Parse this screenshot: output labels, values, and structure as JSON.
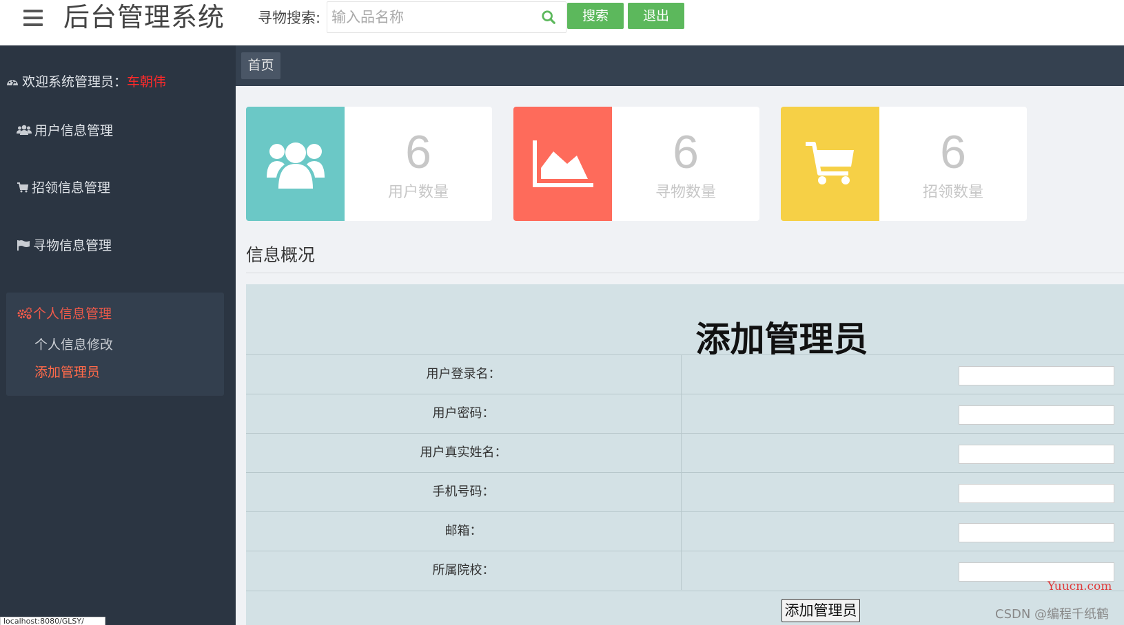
{
  "header": {
    "app_title": "后台管理系统",
    "search_label": "寻物搜索:",
    "search_placeholder": "输入品名称",
    "search_button": "搜索",
    "logout_button": "退出",
    "accent_color": "#5cb85c"
  },
  "sidebar": {
    "welcome_prefix": "欢迎系统管理员：",
    "admin_name": "车朝伟",
    "items": [
      {
        "label": "用户信息管理",
        "icon": "users-icon"
      },
      {
        "label": "招领信息管理",
        "icon": "cart-icon"
      },
      {
        "label": "寻物信息管理",
        "icon": "flag-icon"
      }
    ],
    "group": {
      "label": "个人信息管理",
      "icon": "gears-icon",
      "children": [
        {
          "label": "个人信息修改",
          "active": false
        },
        {
          "label": "添加管理员",
          "active": true
        }
      ]
    }
  },
  "main": {
    "tab_home": "首页",
    "cards": [
      {
        "value": "6",
        "label": "用户数量",
        "color": "#6bc8c6",
        "icon": "users-icon"
      },
      {
        "value": "6",
        "label": "寻物数量",
        "color": "#fe6b5b",
        "icon": "area-chart-icon"
      },
      {
        "value": "6",
        "label": "招领数量",
        "color": "#f6d046",
        "icon": "shopping-cart-icon"
      }
    ],
    "section_title": "信息概况",
    "form": {
      "heading": "添加管理员",
      "fields": [
        {
          "label": "用户登录名：",
          "value": ""
        },
        {
          "label": "用户密码：",
          "value": ""
        },
        {
          "label": "用户真实姓名：",
          "value": ""
        },
        {
          "label": "手机号码：",
          "value": ""
        },
        {
          "label": "邮箱：",
          "value": ""
        },
        {
          "label": "所属院校：",
          "value": ""
        }
      ],
      "submit_label": "添加管理员"
    }
  },
  "watermarks": {
    "yuucn": "Yuucn.com",
    "csdn": "CSDN @编程千纸鹤"
  },
  "status_bar": {
    "url": "localhost:8080/GLSY/"
  }
}
